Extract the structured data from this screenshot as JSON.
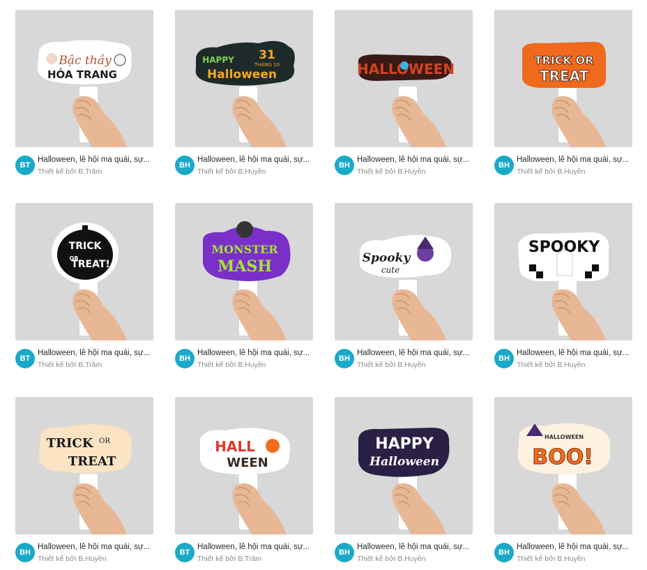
{
  "cards": [
    {
      "title": "Halloween, lễ hội ma quái, sự...",
      "author": "Thiết kế bởi B.Trâm",
      "avatar": "BT",
      "sign_text": [
        "Bậc thầy",
        "HÓA TRANG"
      ],
      "sign_bg": "#ffffff",
      "sign_fg": "#c0392b",
      "style": "bacthay"
    },
    {
      "title": "Halloween, lễ hội ma quái, sự...",
      "author": "Thiết kế bởi B.Huyền",
      "avatar": "BH",
      "sign_text": [
        "HAPPY",
        "31",
        "THÁNG 10",
        "Halloween"
      ],
      "sign_bg": "#1e2a2a",
      "sign_fg": "#f5a623",
      "style": "happy31"
    },
    {
      "title": "Halloween, lễ hội ma quái, sự...",
      "author": "Thiết kế bởi B.Huyền",
      "avatar": "BH",
      "sign_text": [
        "HALLOWEEN"
      ],
      "sign_bg": "#3a1a14",
      "sign_fg": "#d0431f",
      "style": "halloween"
    },
    {
      "title": "Halloween, lễ hội ma quái, sự...",
      "author": "Thiết kế bởi B.Huyền",
      "avatar": "BH",
      "sign_text": [
        "TRICK OR",
        "TREAT"
      ],
      "sign_bg": "#f06a1e",
      "sign_fg": "#ffffff",
      "style": "trickor"
    },
    {
      "title": "Halloween, lễ hội ma quái, sự...",
      "author": "Thiết kế bởi B.Trâm",
      "avatar": "BT",
      "sign_text": [
        "TRICK",
        "OR",
        "TREAT!"
      ],
      "sign_bg": "#111111",
      "sign_fg": "#ffffff",
      "style": "pumpkin"
    },
    {
      "title": "Halloween, lễ hội ma quái, sự...",
      "author": "Thiết kế bởi B.Huyền",
      "avatar": "BH",
      "sign_text": [
        "MONSTER",
        "MASH"
      ],
      "sign_bg": "#7b2fc9",
      "sign_fg": "#a3e635",
      "style": "monster"
    },
    {
      "title": "Halloween, lễ hội ma quái, sự...",
      "author": "Thiết kế bởi B.Huyền",
      "avatar": "BH",
      "sign_text": [
        "Spooky",
        "cute"
      ],
      "sign_bg": "#ffffff",
      "sign_fg": "#222222",
      "style": "spooky"
    },
    {
      "title": "Halloween, lễ hội ma quái, sự...",
      "author": "Thiết kế bởi B.Huyền",
      "avatar": "BH",
      "sign_text": [
        "SPOOKY"
      ],
      "sign_bg": "#ffffff",
      "sign_fg": "#111111",
      "style": "spookyghost"
    },
    {
      "title": "Halloween, lễ hội ma quái, sự...",
      "author": "Thiết kế bởi B.Huyền",
      "avatar": "BH",
      "sign_text": [
        "TRICK",
        "OR",
        "TREAT"
      ],
      "sign_bg": "#fbe3c4",
      "sign_fg": "#1a1a1a",
      "style": "trickcream"
    },
    {
      "title": "Halloween, lễ hội ma quái, sự...",
      "author": "Thiết kế bởi B.Trâm",
      "avatar": "BT",
      "sign_text": [
        "HALL",
        "WEEN"
      ],
      "sign_bg": "#ffffff",
      "sign_fg": "#e0392b",
      "style": "hallween"
    },
    {
      "title": "Halloween, lễ hội ma quái, sự...",
      "author": "Thiết kế bởi B.Huyền",
      "avatar": "BH",
      "sign_text": [
        "HAPPY",
        "Halloween"
      ],
      "sign_bg": "#2a1f45",
      "sign_fg": "#ffffff",
      "style": "happypurple"
    },
    {
      "title": "Halloween, lễ hội ma quái, sự...",
      "author": "Thiết kế bởi B.Huyền",
      "avatar": "BH",
      "sign_text": [
        "HALLOWEEN",
        "BOO!"
      ],
      "sign_bg": "#fdf2e0",
      "sign_fg": "#f36d1f",
      "style": "boo"
    }
  ]
}
